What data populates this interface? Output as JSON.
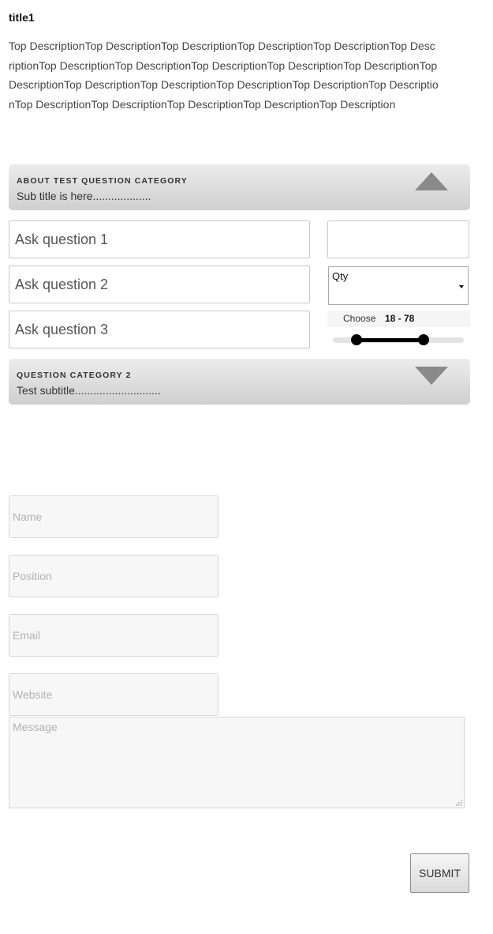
{
  "page": {
    "title": "title1",
    "description": "Top DescriptionTop DescriptionTop DescriptionTop DescriptionTop DescriptionTop DescriptionTop DescriptionTop DescriptionTop DescriptionTop DescriptionTop DescriptionTop DescriptionTop DescriptionTop DescriptionTop DescriptionTop DescriptionTop DescriptionTop DescriptionTop DescriptionTop DescriptionTop DescriptionTop Description"
  },
  "category1": {
    "title": "ABOUT TEST QUESTION CATEGORY",
    "subtitle": "Sub title is here...................",
    "toggle_icon": "triangle-up-icon"
  },
  "questions": [
    {
      "placeholder": "Ask question 1",
      "value": ""
    },
    {
      "placeholder": "Ask question 2",
      "value": ""
    },
    {
      "placeholder": "Ask question 3",
      "value": ""
    }
  ],
  "side_input": {
    "value": ""
  },
  "qty_select": {
    "selected": "Qty"
  },
  "range": {
    "label": "Choose",
    "values_text": "18 - 78",
    "min": 18,
    "max": 78,
    "fill_start": 0.18,
    "fill_end": 0.69
  },
  "category2": {
    "title": "QUESTION CATEGORY 2",
    "subtitle": "Test subtitle............................",
    "toggle_icon": "triangle-down-icon"
  },
  "contact": {
    "name_placeholder": "Name",
    "position_placeholder": "Position",
    "email_placeholder": "Email",
    "website_placeholder": "Website",
    "message_placeholder": "Message"
  },
  "submit": {
    "label": "SUBMIT"
  }
}
